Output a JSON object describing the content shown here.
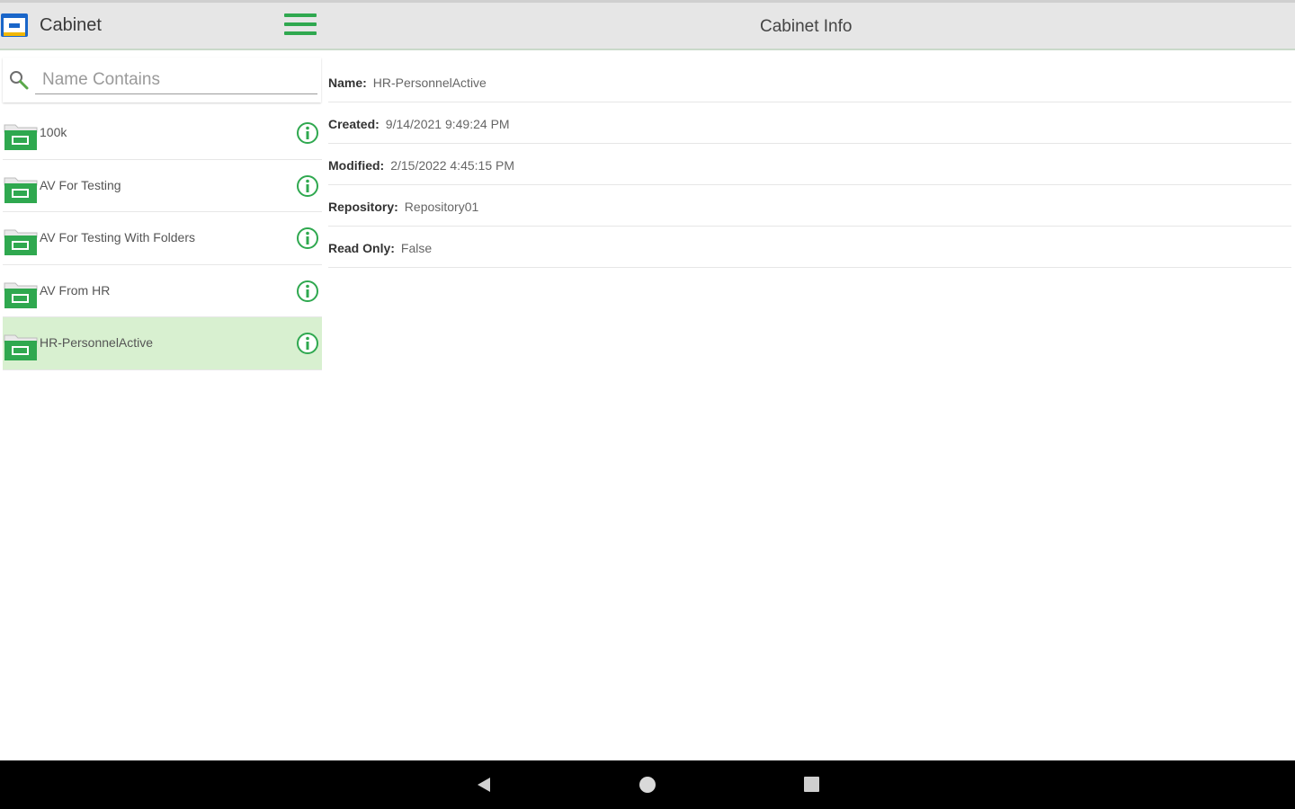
{
  "app": {
    "title": "Cabinet",
    "detail_title": "Cabinet Info",
    "accent_color": "#2fa84f",
    "selected_color": "#d8f0d0"
  },
  "search": {
    "placeholder": "Name Contains",
    "value": ""
  },
  "cabinets": [
    {
      "label": "100k"
    },
    {
      "label": "AV For Testing"
    },
    {
      "label": "AV For Testing With Folders"
    },
    {
      "label": "AV From HR"
    },
    {
      "label": "HR-PersonnelActive",
      "selected": true
    }
  ],
  "info": {
    "name": {
      "label": "Name:",
      "value": "HR-PersonnelActive"
    },
    "created": {
      "label": "Created:",
      "value": "9/14/2021 9:49:24 PM"
    },
    "modified": {
      "label": "Modified:",
      "value": "2/15/2022 4:45:15 PM"
    },
    "repository": {
      "label": "Repository:",
      "value": "Repository01"
    },
    "read_only": {
      "label": "Read Only:",
      "value": "False"
    }
  },
  "icons": {
    "app": "cabinet-app-icon",
    "menu": "hamburger-menu-icon",
    "search": "search-icon",
    "folder": "folder-icon",
    "info": "info-icon",
    "nav_back": "back-triangle-icon",
    "nav_home": "home-circle-icon",
    "nav_recent": "recents-square-icon"
  }
}
